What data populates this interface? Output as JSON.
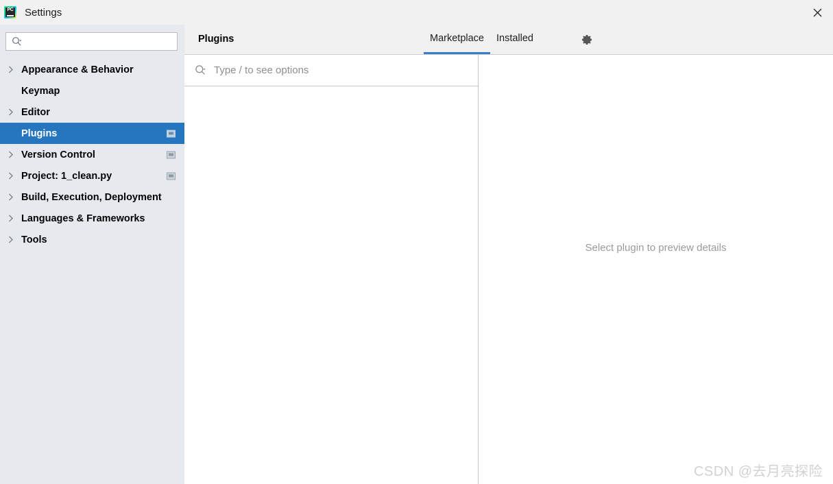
{
  "window": {
    "title": "Settings",
    "app_icon": "pycharm-icon",
    "app_icon_text": "PC",
    "close_label": "✕"
  },
  "sidebar": {
    "search": {
      "value": "",
      "placeholder": "",
      "icon": "search-icon"
    },
    "items": [
      {
        "label": "Appearance & Behavior",
        "expandable": true,
        "selected": false,
        "project_icon": false
      },
      {
        "label": "Keymap",
        "expandable": false,
        "selected": false,
        "project_icon": false
      },
      {
        "label": "Editor",
        "expandable": true,
        "selected": false,
        "project_icon": false
      },
      {
        "label": "Plugins",
        "expandable": false,
        "selected": true,
        "project_icon": true
      },
      {
        "label": "Version Control",
        "expandable": true,
        "selected": false,
        "project_icon": true
      },
      {
        "label": "Project: 1_clean.py",
        "expandable": true,
        "selected": false,
        "project_icon": true
      },
      {
        "label": "Build, Execution, Deployment",
        "expandable": true,
        "selected": false,
        "project_icon": false
      },
      {
        "label": "Languages & Frameworks",
        "expandable": true,
        "selected": false,
        "project_icon": false
      },
      {
        "label": "Tools",
        "expandable": true,
        "selected": false,
        "project_icon": false
      }
    ]
  },
  "main": {
    "title": "Plugins",
    "tabs": [
      {
        "label": "Marketplace",
        "active": true
      },
      {
        "label": "Installed",
        "active": false
      }
    ],
    "settings_icon": "gear-icon",
    "search": {
      "value": "",
      "placeholder": "Type / to see options",
      "icon": "search-icon"
    },
    "list_state": "loading",
    "loading_icon": "spinner-icon",
    "detail_placeholder": "Select plugin to preview details"
  },
  "watermark": "CSDN @去月亮探险",
  "colors": {
    "accent": "#2675bf",
    "tab_underline": "#3d7cc9",
    "sidebar_bg": "#e6eaee",
    "header_bg": "#f1f1f1",
    "placeholder_text": "#8f8f8f",
    "muted_text": "#9a9a9a"
  }
}
